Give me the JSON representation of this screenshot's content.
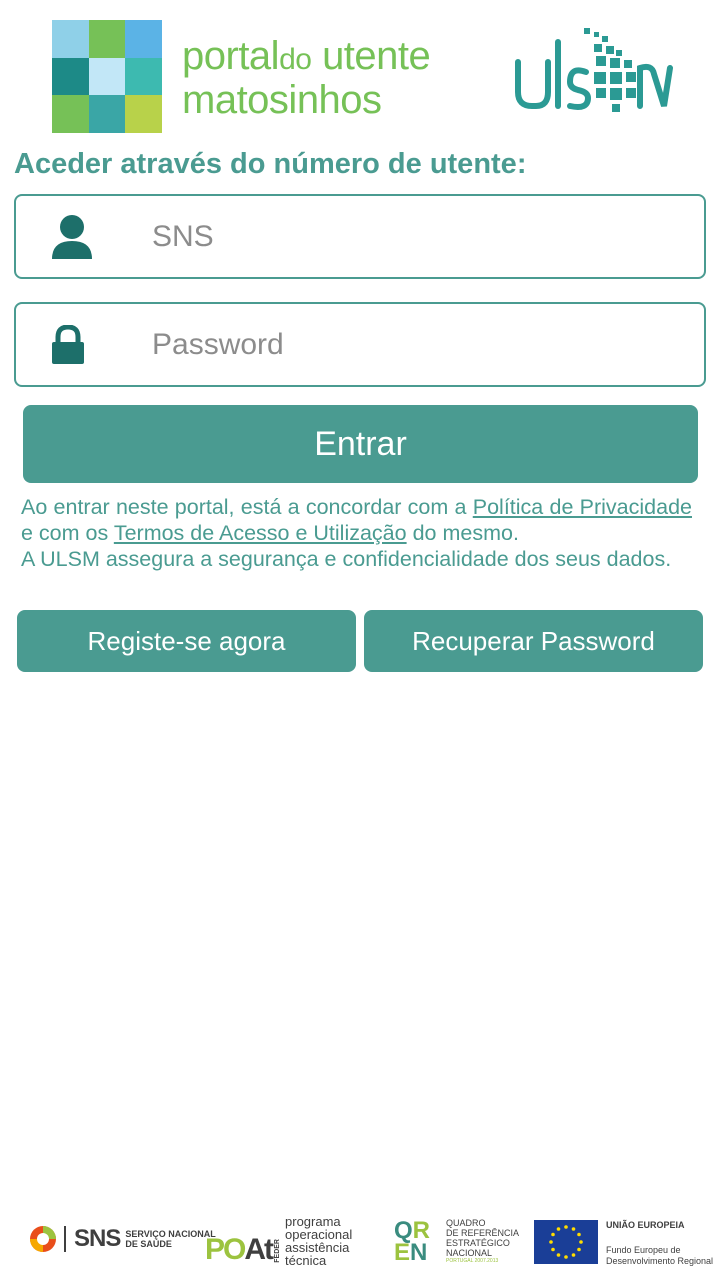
{
  "header": {
    "brand_line1_a": "portal",
    "brand_line1_b": "do",
    "brand_line1_c": "utente",
    "brand_line2": "matosinhos",
    "mosaic_colors": [
      "#8fd0e8",
      "#76c157",
      "#5bb3e6",
      "#1d8a87",
      "#c2e7f7",
      "#3dbab0",
      "#76c157",
      "#3aa6a6",
      "#b8d24a"
    ],
    "ulsm_logo_text": "ulsm"
  },
  "login": {
    "title": "Aceder através do número de utente:",
    "sns_placeholder": "SNS",
    "password_placeholder": "Password",
    "enter_label": "Entrar"
  },
  "terms": {
    "part1": "Ao entrar neste portal, está a concordar com a ",
    "privacy_link": "Política de Privacidade",
    "part2": " e com os ",
    "terms_link": "Termos de Acesso e Utilização",
    "part3": " do mesmo.",
    "security_text": "A ULSM assegura a segurança e confidencialidade dos seus dados."
  },
  "actions": {
    "register_label": "Registe-se agora",
    "recover_label": "Recuperar Password"
  },
  "footer": {
    "sns_word": "SNS",
    "sns_sub1": "SERVIÇO NACIONAL",
    "sns_sub2": "DE SAÚDE",
    "po_word": "PO",
    "po_suffix": "At",
    "feder": "FEDER",
    "po_line1": "programa",
    "po_line2": "operacional",
    "po_line3": "assistência",
    "po_line4": "técnica",
    "qren_q": "Q",
    "qren_r": "R",
    "qren_e": "E",
    "qren_n": "N",
    "qren_line1": "QUADRO",
    "qren_line2": "DE REFERÊNCIA",
    "qren_line3": "ESTRATÉGICO",
    "qren_line4": "NACIONAL",
    "qren_mini": "PORTUGAL 2007.2013",
    "eu_top": "UNIÃO EUROPEIA",
    "eu_line1": "Fundo Europeu de",
    "eu_line2": "Desenvolvimento Regional"
  },
  "colors": {
    "accent": "#4a9b91",
    "brand_green": "#76c157"
  }
}
